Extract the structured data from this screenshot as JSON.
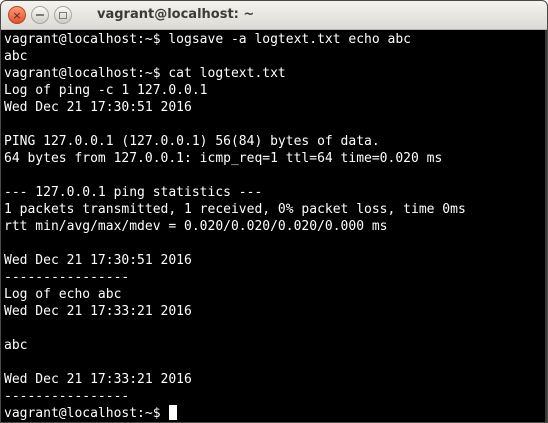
{
  "window": {
    "title": "vagrant@localhost: ~",
    "close_glyph": "×"
  },
  "terminal": {
    "lines": [
      "vagrant@localhost:~$ logsave -a logtext.txt echo abc",
      "abc",
      "vagrant@localhost:~$ cat logtext.txt",
      "Log of ping -c 1 127.0.0.1",
      "Wed Dec 21 17:30:51 2016",
      "",
      "PING 127.0.0.1 (127.0.0.1) 56(84) bytes of data.",
      "64 bytes from 127.0.0.1: icmp_req=1 ttl=64 time=0.020 ms",
      "",
      "--- 127.0.0.1 ping statistics ---",
      "1 packets transmitted, 1 received, 0% packet loss, time 0ms",
      "rtt min/avg/max/mdev = 0.020/0.020/0.020/0.000 ms",
      "",
      "Wed Dec 21 17:30:51 2016",
      "----------------",
      "Log of echo abc",
      "Wed Dec 21 17:33:21 2016",
      "",
      "abc",
      "",
      "Wed Dec 21 17:33:21 2016",
      "----------------"
    ],
    "prompt": "vagrant@localhost:~$ "
  }
}
